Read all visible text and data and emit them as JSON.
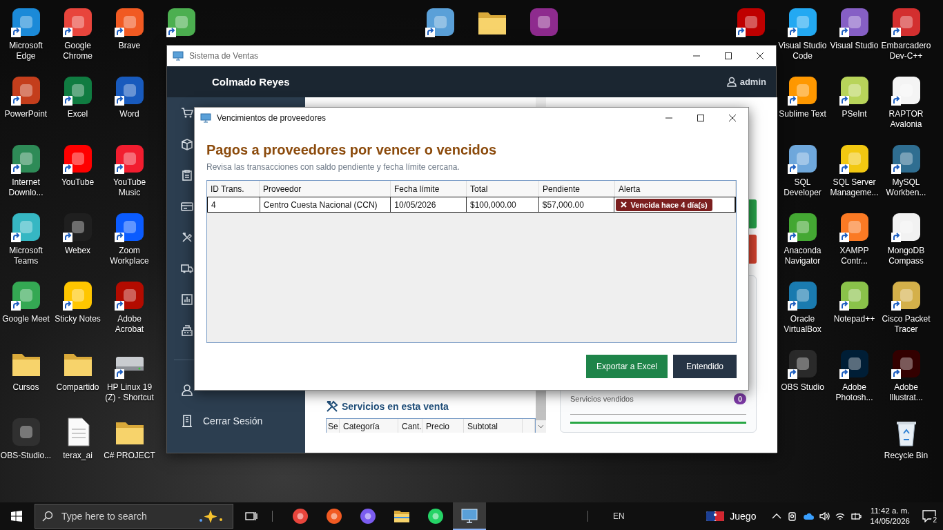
{
  "desktop": {
    "icons": [
      {
        "label": "Microsoft Edge",
        "kind": "app",
        "color": "#1b8ad8",
        "shortcut": true
      },
      {
        "label": "Google Chrome",
        "kind": "app",
        "color": "#e8453c",
        "shortcut": true
      },
      {
        "label": "Brave",
        "kind": "app",
        "color": "#f15a22",
        "shortcut": true
      },
      {
        "kind": "app",
        "color": "#4caf50",
        "shortcut": true
      },
      {
        "kind": "app",
        "color": "#5aa0d8",
        "shortcut": true
      },
      {
        "kind": "folder",
        "shortcut": false
      },
      {
        "kind": "app",
        "color": "#8e2b8e",
        "shortcut": false
      },
      {
        "kind": "app",
        "color": "#bf0000",
        "shortcut": true
      },
      {
        "label": "Visual Studio Code",
        "kind": "app",
        "color": "#23a9f2",
        "shortcut": true
      },
      {
        "label": "Visual Studio",
        "kind": "app",
        "color": "#865fc5",
        "shortcut": true
      },
      {
        "label": "Embarcadero Dev-C++",
        "kind": "app",
        "color": "#d32f2f",
        "shortcut": true
      },
      {
        "label": "PowerPoint",
        "kind": "app",
        "color": "#c43e1c",
        "shortcut": true
      },
      {
        "label": "Excel",
        "kind": "app",
        "color": "#107c41",
        "shortcut": true
      },
      {
        "label": "Word",
        "kind": "app",
        "color": "#185abd",
        "shortcut": true
      },
      {
        "label": "Sublime Text",
        "kind": "app",
        "color": "#ff9800",
        "shortcut": true
      },
      {
        "label": "PSeInt",
        "kind": "app",
        "color": "#b8d45a",
        "shortcut": true
      },
      {
        "label": "RAPTOR Avalonia",
        "kind": "app",
        "color": "#f4f4f4",
        "shortcut": true
      },
      {
        "label": "Internet Downlo...",
        "kind": "app",
        "color": "#2e8b57",
        "shortcut": true
      },
      {
        "label": "YouTube",
        "kind": "app",
        "color": "#ff0000",
        "shortcut": true
      },
      {
        "label": "YouTube Music",
        "kind": "app",
        "color": "#f21d2f",
        "shortcut": true
      },
      {
        "label": "SQL Developer",
        "kind": "app",
        "color": "#6fa8dc",
        "shortcut": true
      },
      {
        "label": "SQL Server Manageme...",
        "kind": "app",
        "color": "#f2c811",
        "shortcut": true
      },
      {
        "label": "MySQL Workben...",
        "kind": "app",
        "color": "#2f6e91",
        "shortcut": true
      },
      {
        "label": "Microsoft Teams",
        "kind": "app",
        "color": "#36b7c3",
        "shortcut": true
      },
      {
        "label": "Webex",
        "kind": "app",
        "color": "#1f1f1f",
        "shortcut": true
      },
      {
        "label": "Zoom Workplace",
        "kind": "app",
        "color": "#0b5cff",
        "shortcut": true
      },
      {
        "label": "Anaconda Navigator",
        "kind": "app",
        "color": "#44a833",
        "shortcut": true
      },
      {
        "label": "XAMPP Contr...",
        "kind": "app",
        "color": "#fb7a24",
        "shortcut": true
      },
      {
        "label": "MongoDB Compass",
        "kind": "app",
        "color": "#f2f2f2",
        "shortcut": true
      },
      {
        "label": "Google Meet",
        "kind": "app",
        "color": "#34a853",
        "shortcut": true
      },
      {
        "label": "Sticky Notes",
        "kind": "app",
        "color": "#ffc600",
        "shortcut": true
      },
      {
        "label": "Adobe Acrobat",
        "kind": "app",
        "color": "#b30b00",
        "shortcut": true
      },
      {
        "label": "Oracle VirtualBox",
        "kind": "app",
        "color": "#1a7bb0",
        "shortcut": true
      },
      {
        "label": "Notepad++",
        "kind": "app",
        "color": "#8ac24a",
        "shortcut": true
      },
      {
        "label": "Cisco Packet Tracer",
        "kind": "app",
        "color": "#d4b04a",
        "shortcut": true
      },
      {
        "label": "Cursos",
        "kind": "folder",
        "shortcut": false
      },
      {
        "label": "Compartido",
        "kind": "folder",
        "shortcut": false
      },
      {
        "label": "HP Linux 19 (Z) - Shortcut",
        "kind": "drive",
        "shortcut": true
      },
      {
        "label": "OBS Studio",
        "kind": "app",
        "color": "#2a2a2a",
        "shortcut": true
      },
      {
        "label": "Adobe Photosh...",
        "kind": "app",
        "color": "#001e36",
        "shortcut": true
      },
      {
        "label": "Adobe Illustrat...",
        "kind": "app",
        "color": "#330000",
        "shortcut": true
      },
      {
        "label": "OBS-Studio...",
        "kind": "app",
        "color": "#303030",
        "shortcut": false
      },
      {
        "label": "terax_ai",
        "kind": "file",
        "shortcut": false
      },
      {
        "label": "C# PROJECT",
        "kind": "folder",
        "shortcut": false
      },
      {
        "label": "Recycle Bin",
        "kind": "bin",
        "shortcut": false
      }
    ]
  },
  "main_window": {
    "title": "Sistema de Ventas",
    "brand": "Colmado Reyes",
    "user": "admin",
    "sidebar": {
      "footer_items": [
        {
          "label": "Cerrar Sesión"
        }
      ]
    },
    "action_buttons": [
      {
        "kind": "confirm"
      },
      {
        "kind": "cancel"
      }
    ],
    "summary_card": {
      "label": "Servicios vendidos",
      "count": "0"
    },
    "services": {
      "heading": "Servicios en esta venta",
      "columns": [
        "Se",
        "Categoría",
        "Cant.",
        "Precio",
        "Subtotal"
      ]
    }
  },
  "dialog": {
    "title": "Vencimientos de proveedores",
    "heading": "Pagos a proveedores por vencer o vencidos",
    "subtitle": "Revisa las transacciones con saldo pendiente y fecha límite cercana.",
    "table": {
      "columns": [
        "ID Trans.",
        "Proveedor",
        "Fecha límite",
        "Total",
        "Pendiente",
        "Alerta"
      ],
      "rows": [
        {
          "cells": [
            "4",
            "Centro Cuesta Nacional (CCN)",
            "10/05/2026",
            "$100,000.00",
            "$57,000.00"
          ],
          "alert": {
            "kind": "overdue",
            "text": "Vencida hace 4 día(s)"
          }
        }
      ]
    },
    "buttons": [
      {
        "label": "Exportar a Excel",
        "kind": "primary"
      },
      {
        "label": "Entendido",
        "kind": "secondary"
      }
    ]
  },
  "taskbar": {
    "search": {
      "placeholder": "Type here to search"
    },
    "apps": [
      {
        "kind": "app",
        "color": "#e8453c",
        "active": false
      },
      {
        "kind": "app",
        "color": "#f15a22",
        "active": false
      },
      {
        "kind": "app",
        "color": "#7b5cf0",
        "active": false
      },
      {
        "kind": "folder",
        "active": false
      },
      {
        "kind": "app",
        "color": "#25d366",
        "active": false
      },
      {
        "kind": "monitor",
        "active": true
      }
    ],
    "language": "EN",
    "widget": {
      "label": "Juego"
    },
    "clock": {
      "time": "11:42 a. m.",
      "date": "14/05/2026"
    },
    "notification_count": "2"
  }
}
